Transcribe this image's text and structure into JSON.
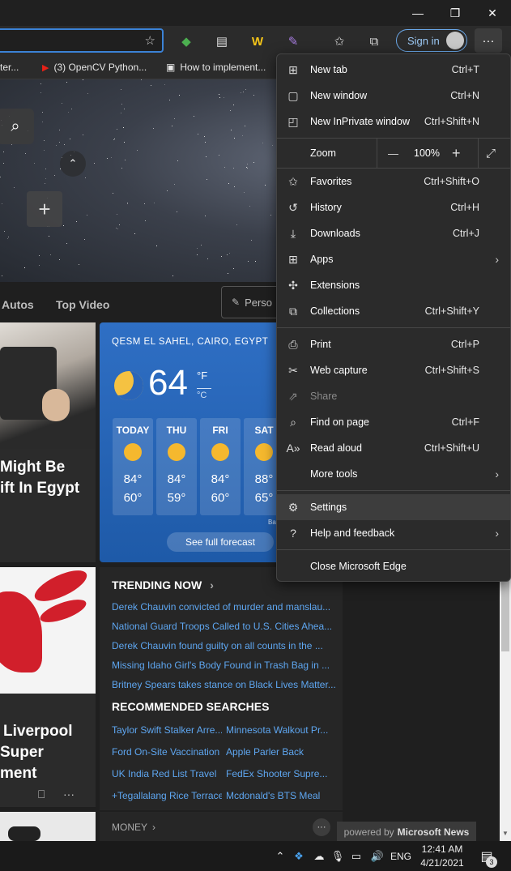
{
  "titlebar": {
    "minimize": "—",
    "maximize": "❐",
    "close": "✕"
  },
  "toolbar": {
    "favorite_add_icon": "☆",
    "extensions": [
      "◆",
      "▤",
      "W",
      "✎"
    ],
    "favorites_icon": "✩",
    "collections_icon": "⧉",
    "sign_in": "Sign in",
    "more": "···"
  },
  "bookmarks": [
    {
      "label": "ter...",
      "icon": ""
    },
    {
      "label": "(3) OpenCV Python...",
      "icon": "▶",
      "color": "#e62117"
    },
    {
      "label": "How to implement...",
      "icon": "▣",
      "color": "#dddddd"
    }
  ],
  "hero": {
    "search_icon": "⌕",
    "collapse_icon": "⌃",
    "add_tile": "+"
  },
  "feed": {
    "tabs": [
      "Autos",
      "Top Video"
    ],
    "personalize": "Perso",
    "card1": {
      "headline_lines": [
        "Might Be",
        "ift In Egypt"
      ]
    },
    "card2": {
      "headline_lines": [
        "Liverpool",
        "Super",
        "ment"
      ],
      "save_icon": "⎕",
      "more": "···"
    },
    "bottom_more": "···",
    "money": "MONEY",
    "powered_prefix": "powered by",
    "powered_brand": "Microsoft News"
  },
  "weather": {
    "location": "QESM EL SAHEL, CAIRO, EGYPT",
    "temp": "64",
    "unit_f": "°F",
    "unit_c": "°C",
    "forecast": [
      {
        "day": "TODAY",
        "hi": "84°",
        "lo": "60°"
      },
      {
        "day": "THU",
        "hi": "84°",
        "lo": "59°"
      },
      {
        "day": "FRI",
        "hi": "84°",
        "lo": "60°"
      },
      {
        "day": "SAT",
        "hi": "88°",
        "lo": "65°"
      }
    ],
    "attribution": "Ba",
    "full_forecast": "See full forecast"
  },
  "trending": {
    "title": "TRENDING NOW",
    "items": [
      "Derek Chauvin convicted of murder and manslau...",
      "National Guard Troops Called to U.S. Cities Ahea...",
      "Derek Chauvin found guilty on all counts in the ...",
      "Missing Idaho Girl's Body Found in Trash Bag in ...",
      "Britney Spears takes stance on Black Lives Matter..."
    ],
    "recommended_title": "RECOMMENDED SEARCHES",
    "recommended": [
      "Taylor Swift Stalker Arre...",
      "Minnesota Walkout Pr...",
      "Ford On-Site Vaccination",
      "Apple Parler Back",
      "UK India Red List Travel",
      "FedEx Shooter Supre...",
      "+Tegallalang Rice Terrace",
      "Mcdonald's BTS Meal"
    ]
  },
  "menu": {
    "new_tab": {
      "label": "New tab",
      "shortcut": "Ctrl+T"
    },
    "new_window": {
      "label": "New window",
      "shortcut": "Ctrl+N"
    },
    "inprivate": {
      "label": "New InPrivate window",
      "shortcut": "Ctrl+Shift+N"
    },
    "zoom": {
      "label": "Zoom",
      "minus": "—",
      "value": "100%",
      "plus": "+",
      "fullscreen": "⤢"
    },
    "favorites": {
      "label": "Favorites",
      "shortcut": "Ctrl+Shift+O"
    },
    "history": {
      "label": "History",
      "shortcut": "Ctrl+H"
    },
    "downloads": {
      "label": "Downloads",
      "shortcut": "Ctrl+J"
    },
    "apps": {
      "label": "Apps"
    },
    "extensions": {
      "label": "Extensions"
    },
    "collections": {
      "label": "Collections",
      "shortcut": "Ctrl+Shift+Y"
    },
    "print": {
      "label": "Print",
      "shortcut": "Ctrl+P"
    },
    "web_capture": {
      "label": "Web capture",
      "shortcut": "Ctrl+Shift+S"
    },
    "share": {
      "label": "Share"
    },
    "find": {
      "label": "Find on page",
      "shortcut": "Ctrl+F"
    },
    "read_aloud": {
      "label": "Read aloud",
      "shortcut": "Ctrl+Shift+U"
    },
    "more_tools": {
      "label": "More tools"
    },
    "settings": {
      "label": "Settings"
    },
    "help": {
      "label": "Help and feedback"
    },
    "close": {
      "label": "Close Microsoft Edge"
    },
    "arrow": "›"
  },
  "taskbar": {
    "chevron": "⌃",
    "lang": "ENG",
    "time": "12:41 AM",
    "date": "4/21/2021",
    "notif_count": "3"
  }
}
